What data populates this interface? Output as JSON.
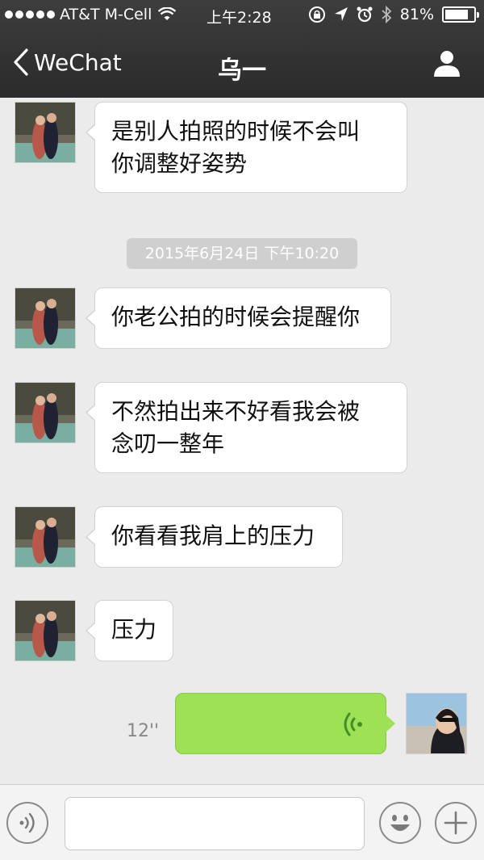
{
  "status_bar": {
    "carrier": "AT&T M-Cell",
    "time": "上午2:28",
    "battery_text": "81%",
    "battery_level": 0.81,
    "icons": [
      "signal-dots-icon",
      "wifi-icon",
      "rotation-lock-icon",
      "location-icon",
      "alarm-icon",
      "bluetooth-icon",
      "battery-icon"
    ]
  },
  "nav": {
    "back_label": "WeChat",
    "title": "乌一",
    "right_icon": "person-icon"
  },
  "messages": [
    {
      "side": "in",
      "lines": [
        "是别人拍照的时候不会叫",
        "你调整好姿势"
      ]
    },
    {
      "type": "timestamp",
      "text": "2015年6月24日 下午10:20"
    },
    {
      "side": "in",
      "lines": [
        "你老公拍的时候会提醒你"
      ]
    },
    {
      "side": "in",
      "lines": [
        "不然拍出来不好看我会被",
        "念叨一整年"
      ]
    },
    {
      "side": "in",
      "lines": [
        "你看看我肩上的压力"
      ]
    },
    {
      "side": "in",
      "lines": [
        "压力"
      ]
    },
    {
      "side": "out",
      "type": "voice",
      "duration": "12''"
    }
  ],
  "input_bar": {
    "left_icon": "voice-mode-icon",
    "text_value": "",
    "emoji_icon": "emoji-icon",
    "plus_icon": "plus-icon"
  },
  "colors": {
    "header_bg": "#2f2f2f",
    "chat_bg": "#ebebeb",
    "outgoing_bubble": "#9de255",
    "incoming_bubble": "#ffffff",
    "timestamp_bg": "#cfcfcf"
  }
}
